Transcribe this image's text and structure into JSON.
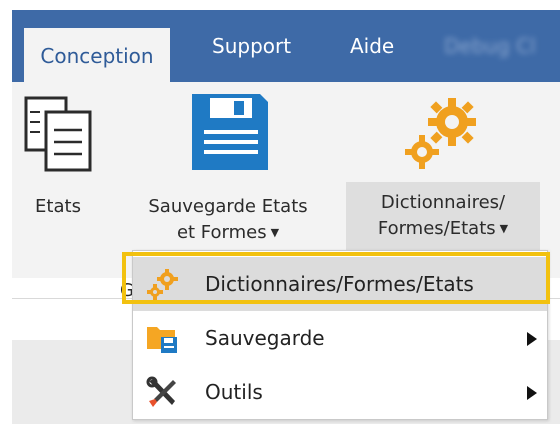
{
  "menubar": {
    "tabs": [
      {
        "label": "Conception",
        "active": true
      },
      {
        "label": "Support",
        "active": false
      },
      {
        "label": "Aide",
        "active": false
      },
      {
        "label": "Debug Cl",
        "blurred": true
      }
    ]
  },
  "ribbon": {
    "buttons": {
      "etats": {
        "label": "Etats",
        "icon": "document-list-icon"
      },
      "sauvegarde": {
        "line1": "Sauvegarde Etats",
        "line2": "et Formes",
        "icon": "floppy-disk-icon"
      },
      "dictionnaires": {
        "line1": "Dictionnaires/",
        "line2": "Formes/Etats",
        "icon": "gears-icon"
      }
    },
    "group_label": "G"
  },
  "dropdown": {
    "items": [
      {
        "label": "Dictionnaires/Formes/Etats",
        "icon": "gears-icon",
        "highlighted": true,
        "has_submenu": false
      },
      {
        "label": "Sauvegarde",
        "icon": "folder-save-icon",
        "has_submenu": true
      },
      {
        "label": "Outils",
        "icon": "tools-icon",
        "has_submenu": true
      }
    ]
  },
  "colors": {
    "menubar": "#3e6aa7",
    "accent_blue": "#1f7ac4",
    "gear_orange": "#f0a01f",
    "highlight": "#f2c10f"
  }
}
